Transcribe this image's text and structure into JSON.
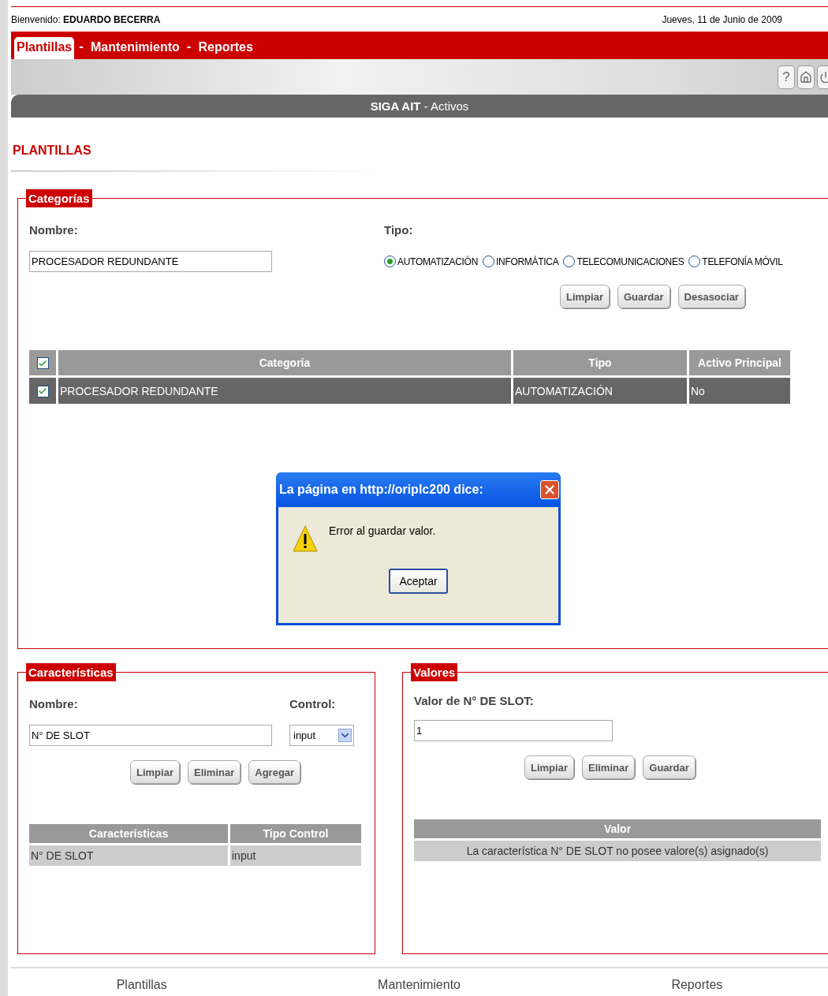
{
  "header": {
    "welcome_label": "Bienvenido:",
    "user": "EDUARDO BECERRA",
    "date": "Jueves, 11 de Junio de 2009"
  },
  "nav": {
    "separator": "-",
    "items": [
      {
        "label": "Plantillas",
        "selected": true
      },
      {
        "label": "Mantenimiento",
        "selected": false
      },
      {
        "label": "Reportes",
        "selected": false
      }
    ]
  },
  "toolbar": {
    "help_glyph": "?"
  },
  "title_bar": "**SIGA AIT** - Activos",
  "page_title": "PLANTILLAS",
  "categorias": {
    "legend": "Categorías",
    "nombre_label": "Nombre:",
    "nombre_value": "PROCESADOR REDUNDANTE",
    "tipo_label": "Tipo:",
    "radios": [
      {
        "label": "AUTOMATIZACIÓN",
        "selected": true
      },
      {
        "label": "INFORMÁTICA",
        "selected": false
      },
      {
        "label": "TELECOMUNICACIONES",
        "selected": false
      },
      {
        "label": "TELEFONÍA MÓVIL",
        "selected": false
      }
    ],
    "buttons": [
      "Limpiar",
      "Guardar",
      "Desasociar"
    ],
    "table": {
      "all_checked": true,
      "columns": [
        "Categoría",
        "Tipo",
        "Activo Principal"
      ],
      "rows": [
        {
          "checked": true,
          "cells": [
            "PROCESADOR REDUNDANTE",
            "AUTOMATIZACIÓN",
            "No"
          ]
        }
      ]
    }
  },
  "dialog": {
    "title": "La página en http://oriplc200 dice:",
    "message": "Error al guardar valor.",
    "button": "Aceptar"
  },
  "caracteristicas": {
    "legend": "Características",
    "nombre_label": "Nombre:",
    "nombre_value": "N° DE SLOT",
    "control_label": "Control:",
    "control_value": "input",
    "buttons": [
      "Limpiar",
      "Eliminar",
      "Agregar"
    ],
    "table": {
      "columns": [
        "Características",
        "Tipo Control"
      ],
      "rows": [
        [
          "N° DE SLOT",
          "input"
        ]
      ]
    }
  },
  "valores": {
    "legend": "Valores",
    "label": "Valor de N° DE SLOT:",
    "value": "1",
    "buttons": [
      "Limpiar",
      "Eliminar",
      "Guardar"
    ],
    "table": {
      "columns": [
        "Valor"
      ],
      "empty_message": "La característica N° DE SLOT no posee valore(s) asignado(s)"
    }
  },
  "footer": [
    "Plantillas",
    "Mantenimiento",
    "Reportes"
  ]
}
